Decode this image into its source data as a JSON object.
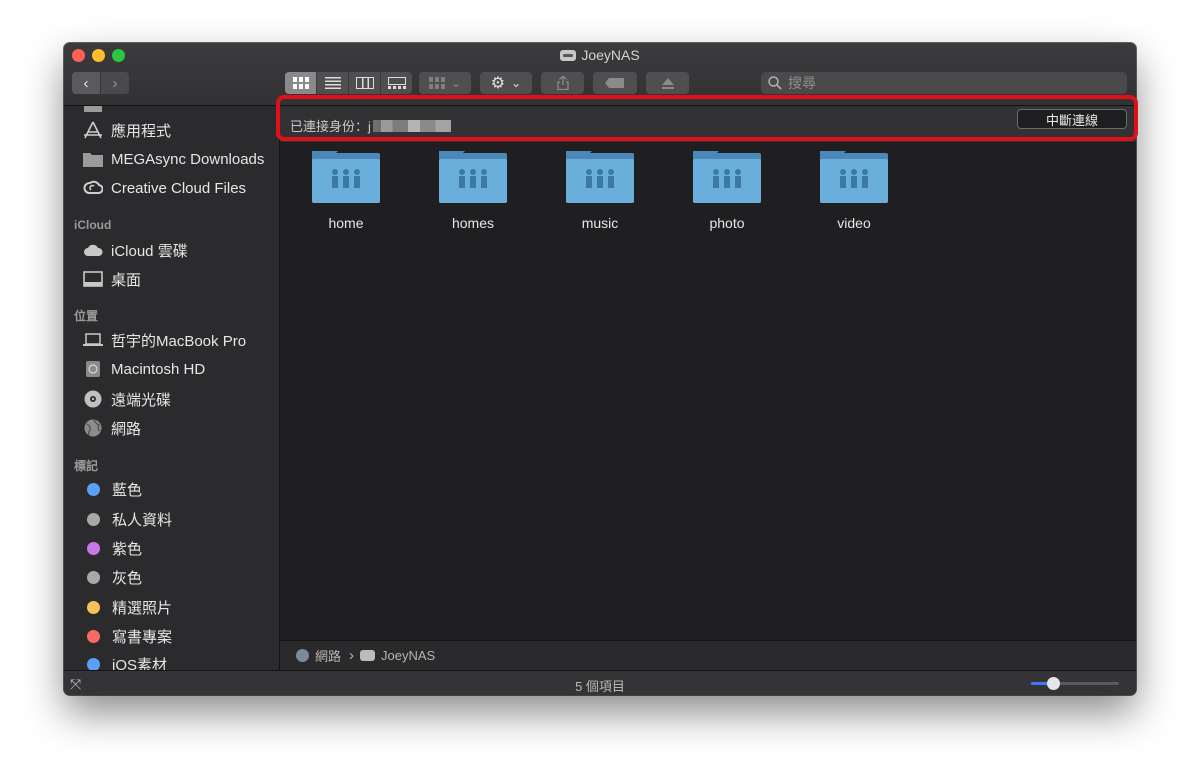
{
  "window": {
    "title": "JoeyNAS"
  },
  "toolbar": {
    "back": "‹",
    "forward": "›",
    "view_modes": [
      "icon",
      "list",
      "column",
      "gallery"
    ],
    "search_placeholder": "搜尋"
  },
  "sidebar": {
    "top_items": [
      {
        "label": "應用程式",
        "icon": "apps-icon"
      },
      {
        "label": "MEGAsync Downloads",
        "icon": "folder-icon"
      },
      {
        "label": "Creative Cloud Files",
        "icon": "creative-cloud-icon"
      }
    ],
    "sections": [
      {
        "title": "iCloud",
        "items": [
          {
            "label": "iCloud 雲碟",
            "icon": "cloud-icon"
          },
          {
            "label": "桌面",
            "icon": "desktop-icon"
          }
        ]
      },
      {
        "title": "位置",
        "items": [
          {
            "label": "哲宇的MacBook Pro",
            "icon": "laptop-icon"
          },
          {
            "label": "Macintosh HD",
            "icon": "disk-icon"
          },
          {
            "label": "遠端光碟",
            "icon": "optical-disc-icon"
          },
          {
            "label": "網路",
            "icon": "network-globe-icon"
          }
        ]
      },
      {
        "title": "標記",
        "items": [
          {
            "label": "藍色",
            "color": "#5aa0f7"
          },
          {
            "label": "私人資料",
            "color": "#a8a8a8"
          },
          {
            "label": "紫色",
            "color": "#c879e8"
          },
          {
            "label": "灰色",
            "color": "#a8a8a8"
          },
          {
            "label": "精選照片",
            "color": "#f7c15a"
          },
          {
            "label": "寫書專案",
            "color": "#f76b63"
          },
          {
            "label": "iOS素材",
            "color": "#5aa0f7"
          }
        ]
      }
    ]
  },
  "connection": {
    "label": "已連接身份：j",
    "disconnect_label": "中斷連線"
  },
  "folders": [
    "home",
    "homes",
    "music",
    "photo",
    "video"
  ],
  "pathbar": {
    "network": "網路",
    "separator": "›",
    "server": "JoeyNAS"
  },
  "status": {
    "count_text": "5 個項目",
    "zoom_level": 0.25
  }
}
